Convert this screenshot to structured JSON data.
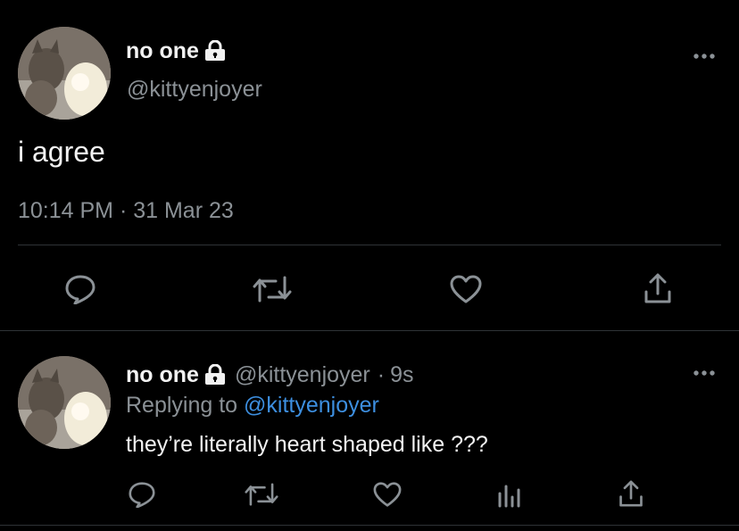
{
  "main_tweet": {
    "display_name": "no one",
    "handle": "@kittyenjoyer",
    "text": "i agree",
    "timestamp": "10:14 PM · 31 Mar 23",
    "icons": {
      "more": "more-icon",
      "lock": "lock-icon",
      "reply": "reply-icon",
      "retweet": "retweet-icon",
      "like": "like-icon",
      "share": "share-icon"
    }
  },
  "reply_tweet": {
    "display_name": "no one",
    "handle": "@kittyenjoyer",
    "separator": "·",
    "age": "9s",
    "replying_to_label": "Replying to",
    "replying_to_handle": "@kittyenjoyer",
    "text": "they’re literally heart shaped like ???",
    "icons": {
      "more": "more-icon",
      "reply": "reply-icon",
      "retweet": "retweet-icon",
      "like": "like-icon",
      "analytics": "analytics-icon",
      "share": "share-icon"
    }
  },
  "colors": {
    "background": "#000000",
    "text": "#e7e9ea",
    "muted": "#8b9196",
    "link": "#3d8fe0",
    "divider": "#2f3336"
  }
}
